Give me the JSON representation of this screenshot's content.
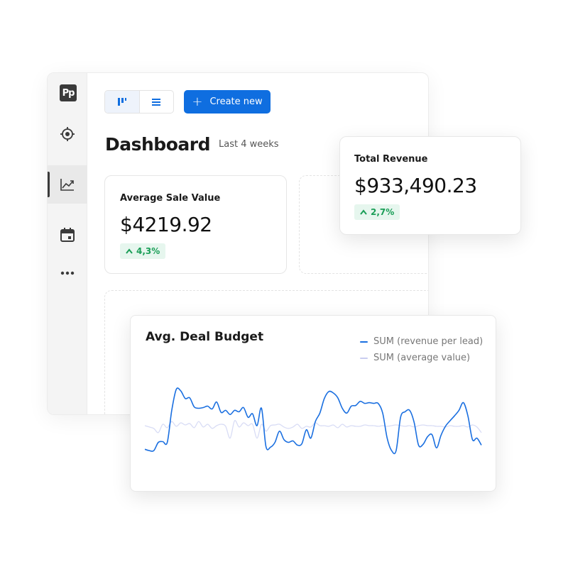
{
  "app": {
    "logo_text": "Pp",
    "sidebar": {
      "items": [
        {
          "icon": "target-icon"
        },
        {
          "icon": "trending-chart-icon",
          "active": true
        },
        {
          "icon": "calendar-icon"
        },
        {
          "icon": "more-dots-icon"
        }
      ]
    },
    "toolbar": {
      "view_options": [
        "board-view-icon",
        "list-view-icon"
      ],
      "create_label": "Create new"
    },
    "header": {
      "title": "Dashboard",
      "range": "Last 4 weeks"
    }
  },
  "kpis": {
    "average_sale": {
      "label": "Average Sale Value",
      "value": "$4219.92",
      "change": "4,3%"
    },
    "total_revenue": {
      "label": "Total Revenue",
      "value": "$933,490.23",
      "change": "2,7%"
    }
  },
  "colors": {
    "accent": "#0f6ee0",
    "series_primary": "#1a6fe0",
    "series_secondary": "#d8dcf5",
    "positive": "#1a9e57",
    "positive_bg": "#e6f6ee"
  },
  "chart_data": {
    "type": "line",
    "title": "Avg. Deal Budget",
    "xlabel": "",
    "ylabel": "",
    "grid": false,
    "legend_position": "top-right",
    "ylim": [
      0,
      100
    ],
    "series": [
      {
        "name": "SUM (revenue per lead)",
        "color": "#1a6fe0",
        "values": [
          14,
          12,
          12,
          24,
          25,
          24,
          70,
          100,
          98,
          87,
          88,
          75,
          73,
          74,
          76,
          72,
          82,
          67,
          70,
          64,
          70,
          68,
          74,
          60,
          65,
          48,
          73,
          18,
          17,
          24,
          40,
          28,
          24,
          26,
          20,
          22,
          42,
          30,
          54,
          66,
          87,
          97,
          95,
          88,
          73,
          66,
          76,
          77,
          83,
          80,
          81,
          80,
          80,
          66,
          30,
          12,
          12,
          60,
          68,
          70,
          53,
          20,
          21,
          32,
          35,
          16,
          34,
          47,
          55,
          62,
          70,
          81,
          62,
          28,
          30,
          20
        ]
      },
      {
        "name": "SUM (average value)",
        "color": "#d8dcf5",
        "values": [
          48,
          46,
          44,
          38,
          50,
          45,
          54,
          47,
          52,
          49,
          51,
          45,
          54,
          46,
          50,
          44,
          48,
          50,
          47,
          30,
          55,
          46,
          52,
          48,
          50,
          30,
          50,
          40,
          48,
          49,
          50,
          46,
          44,
          46,
          50,
          44,
          47,
          46,
          52,
          48,
          48,
          47,
          49,
          45,
          50,
          46,
          48,
          47,
          47,
          49,
          48,
          48,
          47,
          48,
          47,
          48,
          49,
          48,
          47,
          48,
          46,
          48,
          49,
          48,
          48,
          47,
          47,
          46,
          48,
          47,
          47,
          48,
          46,
          49,
          46,
          38
        ]
      }
    ]
  }
}
